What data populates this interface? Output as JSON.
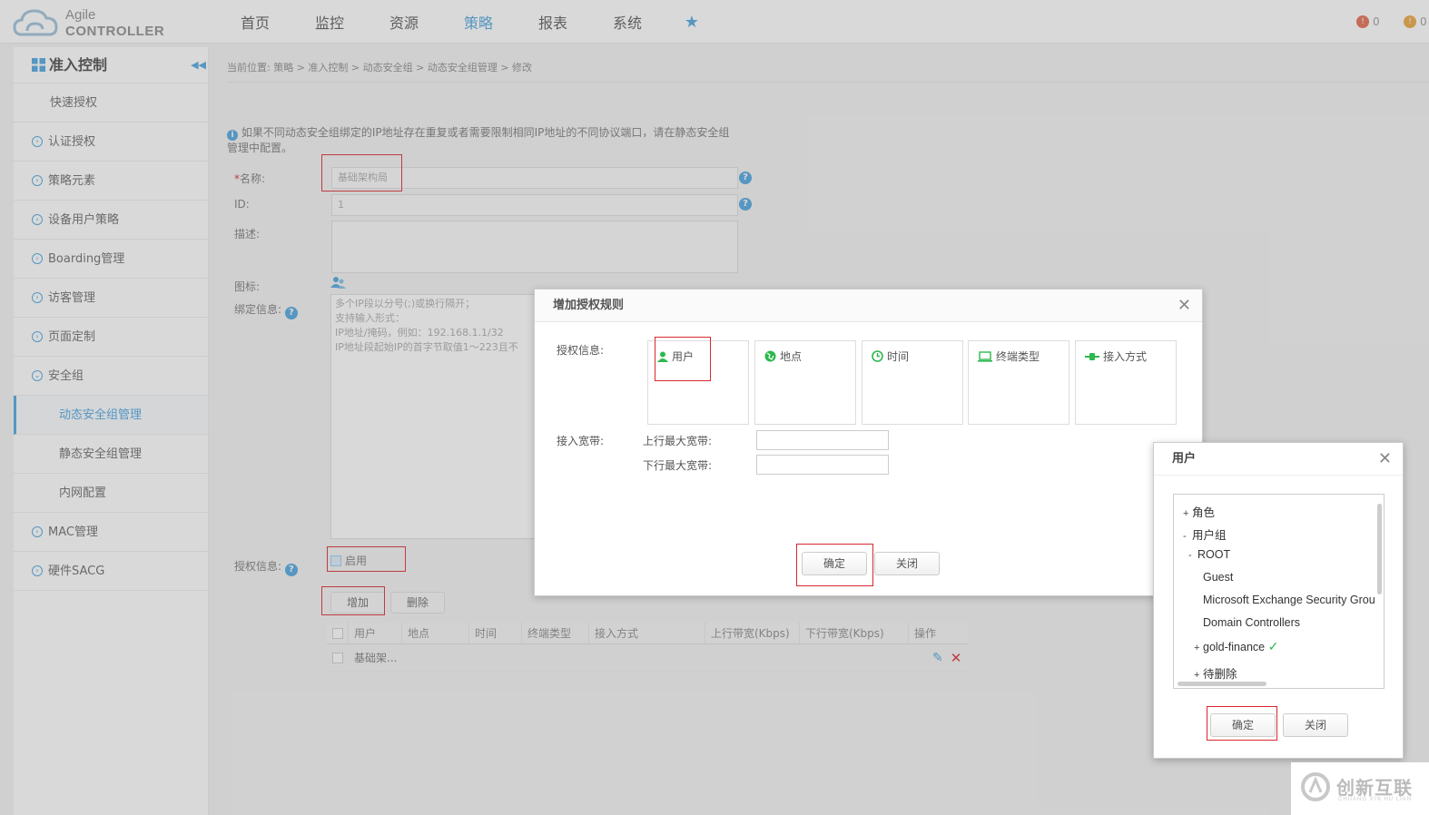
{
  "header": {
    "logo_line1": "Agile",
    "logo_line2": "CONTROLLER",
    "nav": [
      "首页",
      "监控",
      "资源",
      "策略",
      "报表",
      "系统"
    ],
    "active_nav": "策略",
    "badge1": "0",
    "badge2": "0"
  },
  "sidebar": {
    "title": "准入控制",
    "items": [
      "快速授权",
      "认证授权",
      "策略元素",
      "设备用户策略",
      "Boarding管理",
      "访客管理",
      "页面定制",
      "安全组",
      "动态安全组管理",
      "静态安全组管理",
      "内网配置",
      "MAC管理",
      "硬件SACG"
    ]
  },
  "main": {
    "breadcrumb": "当前位置: 策略 > 准入控制 > 动态安全组 > 动态安全组管理 > 修改",
    "notice_line1": "如果不同动态安全组绑定的IP地址存在重复或者需要限制相同IP地址的不同协议端口，请在静态安全组",
    "notice_line2": "管理中配置。",
    "name_label": "名称:",
    "name_value": "基础架构局",
    "id_label": "ID:",
    "id_value": "1",
    "desc_label": "描述:",
    "icon_label": "图标:",
    "bind_label": "绑定信息:",
    "bind_hint1": "多个IP段以分号(;)或换行隔开；",
    "bind_hint2": "支持输入形式：",
    "bind_hint3": "IP地址/掩码，例如：192.168.1.1/32",
    "bind_hint4": "IP地址段起始IP的首字节取值1～223且不",
    "auth_label": "授权信息:",
    "enable_label": "启用",
    "add_button": "增加",
    "delete_button": "删除",
    "table_headers": [
      "用户",
      "地点",
      "时间",
      "终端类型",
      "接入方式",
      "上行带宽(Kbps)",
      "下行带宽(Kbps)",
      "操作"
    ],
    "table_rows": [
      [
        "基础架..."
      ]
    ]
  },
  "dialog_rule": {
    "title": "增加授权规则",
    "auth_info_label": "授权信息:",
    "cards": [
      "用户",
      "地点",
      "时间",
      "终端类型",
      "接入方式"
    ],
    "bandwidth_label": "接入宽带:",
    "up_label": "上行最大宽带:",
    "down_label": "下行最大宽带:",
    "ok": "确定",
    "close": "关闭"
  },
  "dialog_user": {
    "title": "用户",
    "tree": [
      "角色",
      "用户组",
      "ROOT",
      "Guest",
      "Microsoft Exchange Security Grou",
      "Domain Controllers",
      "gold-finance",
      "待删除"
    ],
    "ok": "确定",
    "close": "关闭"
  },
  "watermark": {
    "text": "创新互联",
    "sub": "CHUANG XIN HU LIAN"
  },
  "colors": {
    "accent": "#4aa3df",
    "highlight": "#d9272e",
    "success": "#2db84d"
  }
}
